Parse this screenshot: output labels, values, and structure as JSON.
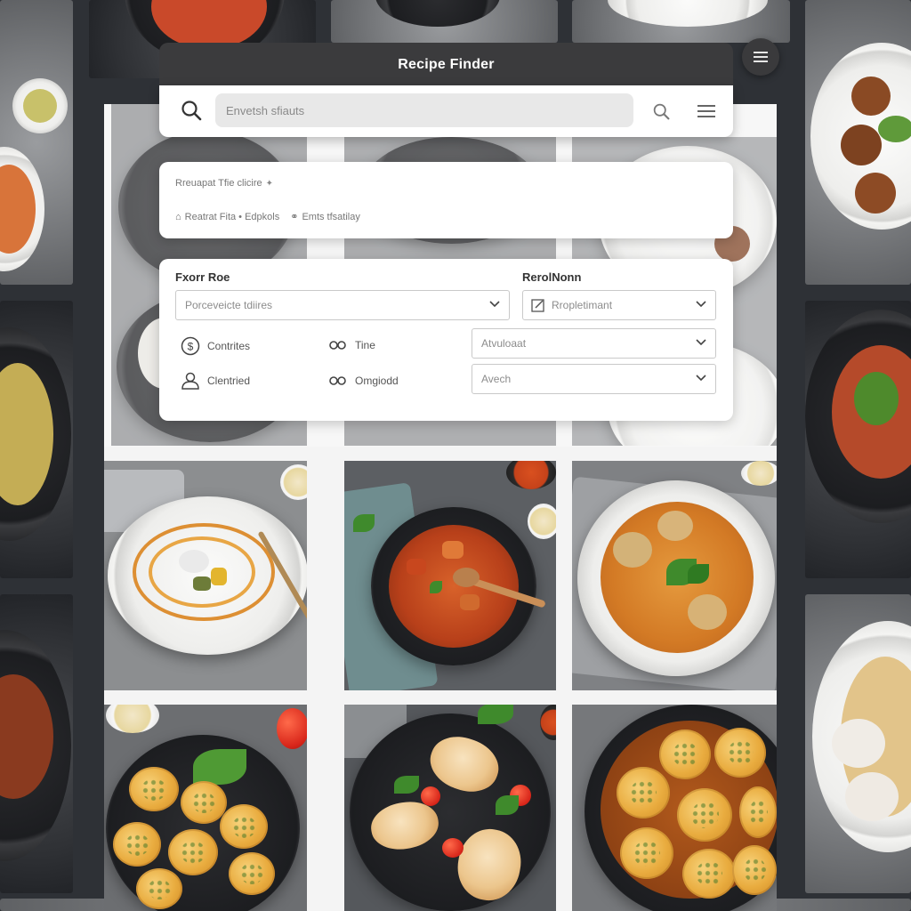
{
  "app": {
    "title": "Recipe Finder"
  },
  "search": {
    "placeholder": "Envetsh sfiauts"
  },
  "info": {
    "line1": "Rreuapat Tfie clicire",
    "line2_a": "Reatrat Fita • Edpkols",
    "line2_b": "Emts tfsatilay"
  },
  "filters": {
    "left_label": "Fxorr Roe",
    "left_select": "Porceveicte tdiires",
    "right_label": "RerolNonn",
    "right_select": "Rropletimant",
    "options": [
      {
        "icon": "dollar-icon",
        "label": "Contrites"
      },
      {
        "icon": "link-icon",
        "label": "Tine"
      },
      {
        "icon": "person-icon",
        "label": "Clentried"
      },
      {
        "icon": "link-icon",
        "label": "Omgiodd"
      }
    ],
    "select_3": "Atvuloaat",
    "select_4": "Avech"
  },
  "colors": {
    "titlebar": "#3b3b3d",
    "panel": "#ffffff",
    "field": "#e8e8e8"
  },
  "recipes": [
    {
      "icon": "pasta-dish"
    },
    {
      "icon": "stew-pan"
    },
    {
      "icon": "curry-plate"
    },
    {
      "icon": "fritters-plate"
    },
    {
      "icon": "chicken-plate"
    },
    {
      "icon": "patties-pan"
    }
  ]
}
